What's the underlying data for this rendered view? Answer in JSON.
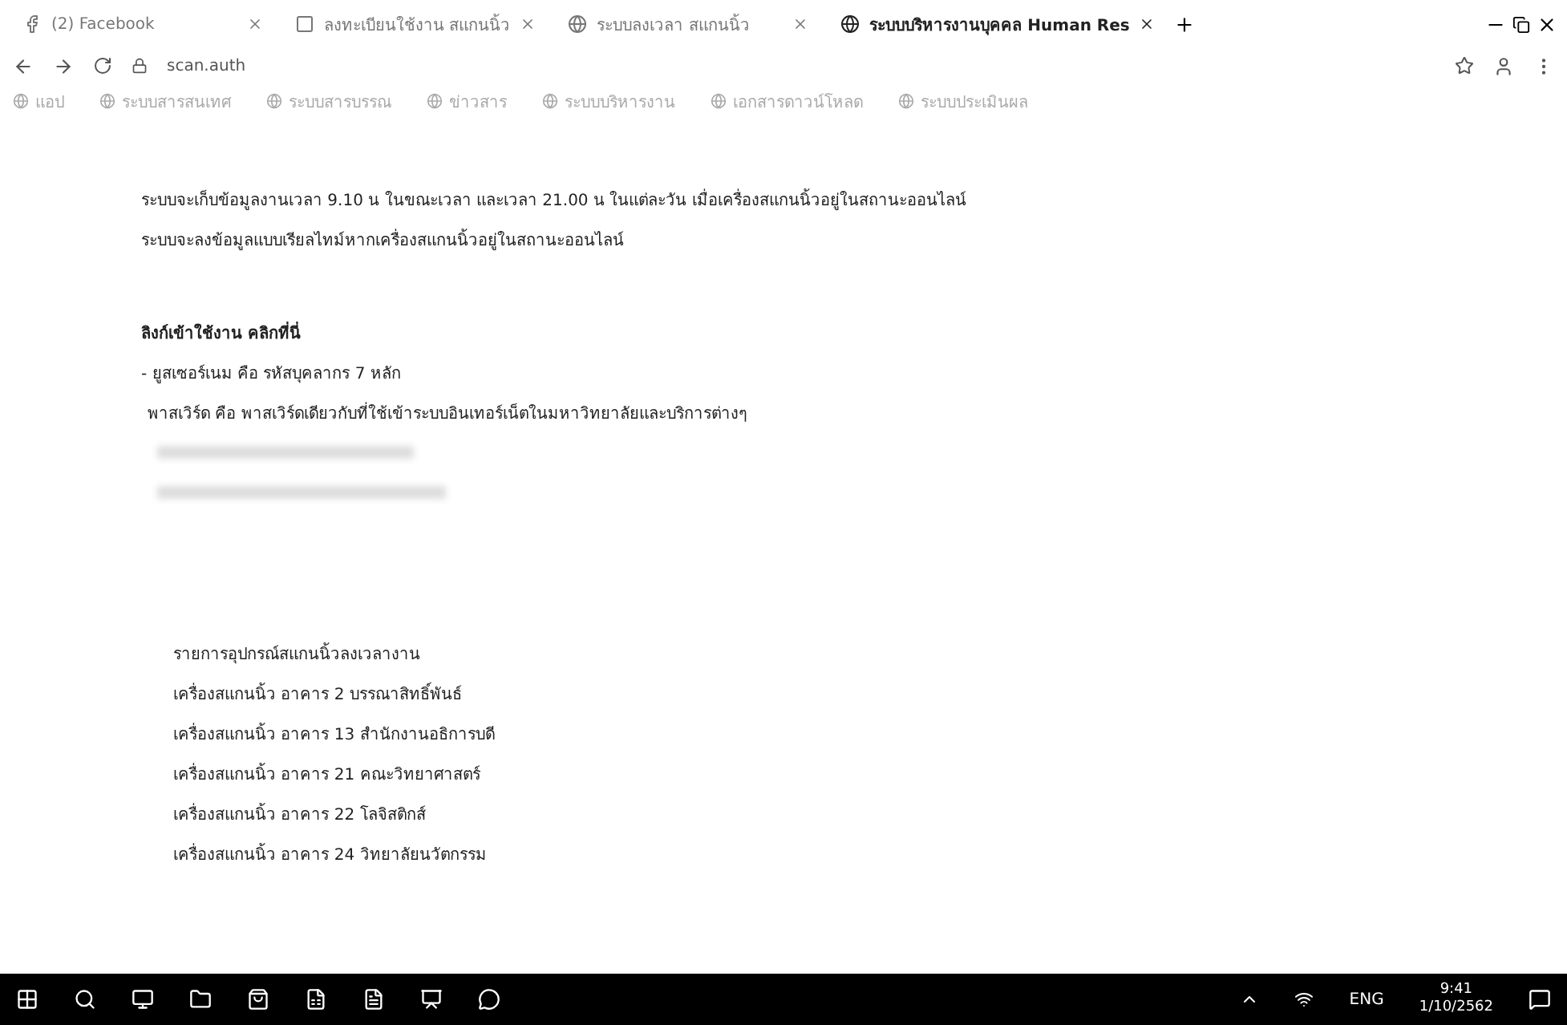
{
  "tabs": [
    {
      "label": "(2) Facebook",
      "selected": false
    },
    {
      "label": "ลงทะเบียนใช้งาน สแกนนิ้ว",
      "selected": false
    },
    {
      "label": "ระบบลงเวลา สแกนนิ้ว",
      "selected": false
    },
    {
      "label": "ระบบบริหารงานบุคคล Human Res",
      "selected": true
    }
  ],
  "address": "scan.auth",
  "bookmarks": [
    {
      "label": "แอป"
    },
    {
      "label": "ระบบสารสนเทศ"
    },
    {
      "label": "ระบบสารบรรณ"
    },
    {
      "label": "ข่าวสาร"
    },
    {
      "label": "ระบบบริหารงาน"
    },
    {
      "label": "เอกสารดาวน์โหลด"
    },
    {
      "label": "ระบบประเมินผล"
    }
  ],
  "notes": [
    "ระบบจะเก็บข้อมูลงานเวลา 9.10 น ในขณะเวลา และเวลา 21.00 น ในแต่ละวัน เมื่อเครื่องสแกนนิ้วอยู่ในสถานะออนไลน์",
    "ระบบจะลงข้อมูลแบบเรียลไทม์หากเครื่องสแกนนิ้วอยู่ในสถานะออนไลน์"
  ],
  "login": {
    "heading": "ลิงก์เข้าใช้งาน คลิกที่นี่",
    "lines": [
      "- ยูสเซอร์เนม คือ รหัสบุคลากร 7 หลัก",
      "พาสเวิร์ด คือ พาสเวิร์ดเดียวกับที่ใช้เข้าระบบอินเทอร์เน็ตในมหาวิทยาลัยและบริการต่างๆ"
    ]
  },
  "devices": {
    "heading": "รายการอุปกรณ์สแกนนิ้วลงเวลางาน",
    "items": [
      "เครื่องสแกนนิ้ว อาคาร 2 บรรณาสิทธิ์พันธ์",
      "เครื่องสแกนนิ้ว อาคาร 13 สำนักงานอธิการบดี",
      "เครื่องสแกนนิ้ว อาคาร 21 คณะวิทยาศาสตร์",
      "เครื่องสแกนนิ้ว อาคาร 22 โลจิสติกส์",
      "เครื่องสแกนนิ้ว อาคาร 24 วิทยาลัยนวัตกรรม"
    ]
  },
  "tray": {
    "language": "ENG",
    "time": "9:41",
    "date": "1/10/2562"
  }
}
